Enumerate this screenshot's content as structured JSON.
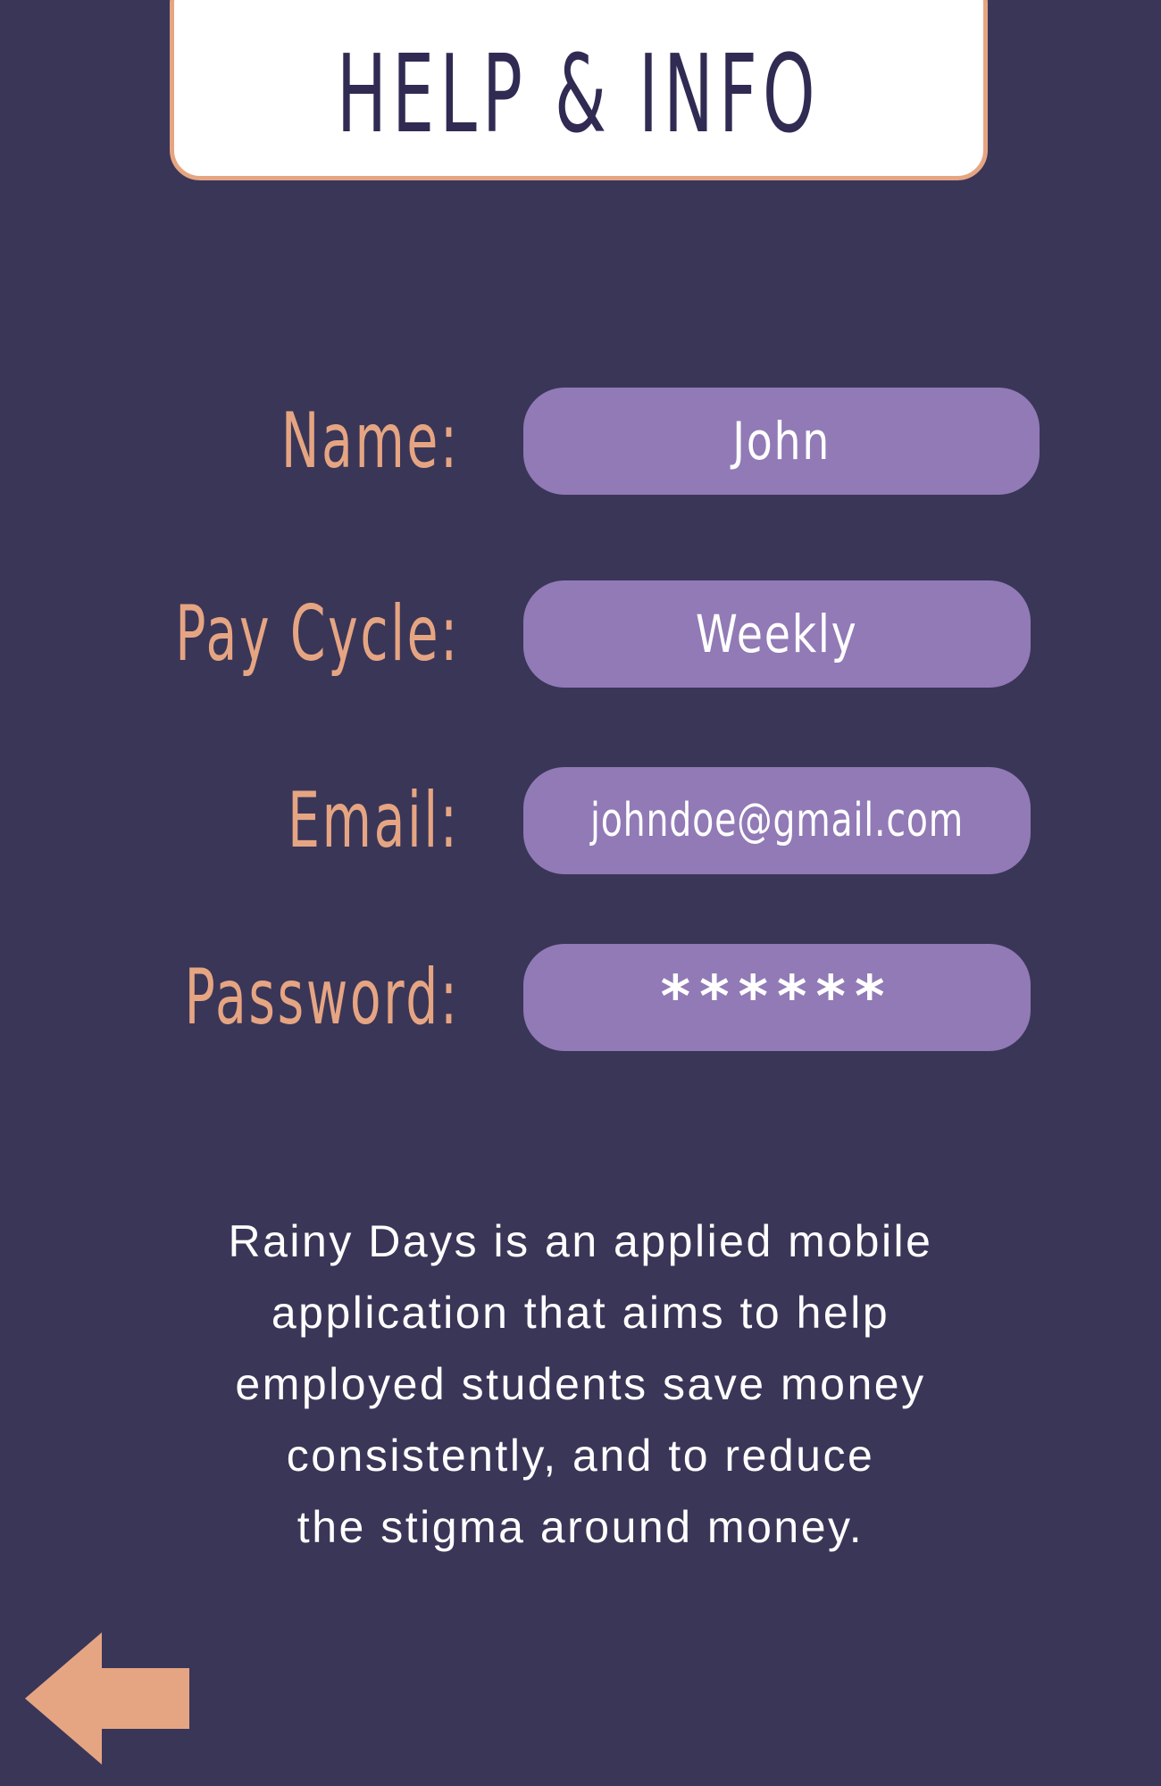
{
  "header": {
    "title": "HELP & INFO"
  },
  "form": {
    "name": {
      "label": "Name:",
      "value": "John"
    },
    "pay_cycle": {
      "label": "Pay Cycle:",
      "value": "Weekly"
    },
    "email": {
      "label": "Email:",
      "value": "johndoe@gmail.com"
    },
    "password": {
      "label": "Password:",
      "value": "******"
    }
  },
  "description": {
    "lines": [
      "Rainy Days is an applied mobile",
      "application that aims to help",
      "employed students save money",
      "consistently, and to reduce",
      "the stigma around money."
    ]
  },
  "navigation": {
    "back_icon": "left-arrow-icon"
  },
  "colors": {
    "background": "#3a3658",
    "accent": "#e6a582",
    "input_fill": "#917ab6",
    "title_text": "#2f2b52",
    "text": "#ffffff"
  }
}
